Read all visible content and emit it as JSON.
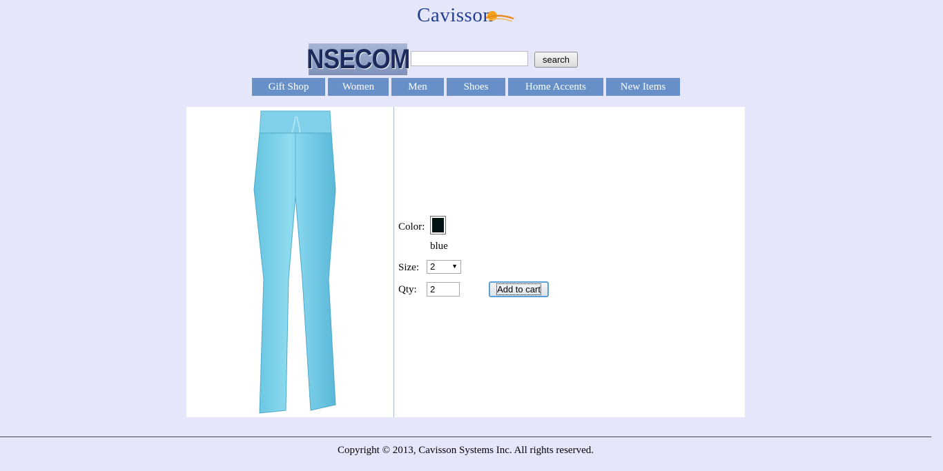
{
  "brand": {
    "name": "Cavisson"
  },
  "logo": {
    "text": "NSECOM"
  },
  "search": {
    "value": "",
    "button_label": "search"
  },
  "nav": {
    "items": [
      {
        "label": "Gift Shop"
      },
      {
        "label": "Women"
      },
      {
        "label": "Men"
      },
      {
        "label": "Shoes"
      },
      {
        "label": "Home Accents"
      },
      {
        "label": "New Items"
      }
    ]
  },
  "product": {
    "image_alt": "blue pants",
    "color_label": "Color:",
    "color_name": "blue",
    "swatch_color": "#041414",
    "size_label": "Size:",
    "size_value": "2",
    "qty_label": "Qty:",
    "qty_value": "2",
    "add_to_cart_label": "Add to cart"
  },
  "footer": {
    "copyright": "Copyright © 2013, Cavisson Systems Inc. All rights reserved."
  },
  "colors": {
    "background": "#e6e6fa",
    "nav": "#6790c8",
    "product": "#7fd0e8"
  }
}
